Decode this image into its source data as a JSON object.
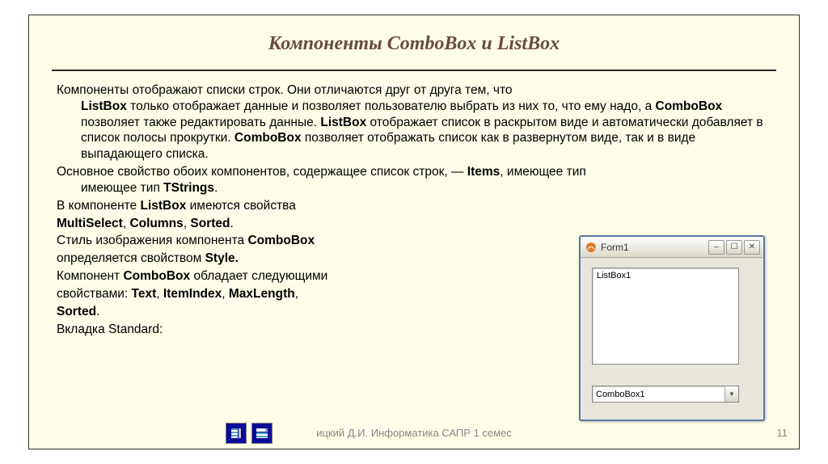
{
  "title": "Компоненты ComboBox и ListBox",
  "para1": {
    "lead": "Компоненты отображают списки строк. Они отличаются друг от друга тем, что",
    "b1": "ListBox",
    "t2": " только отображает данные и позволяет пользователю выбрать из них то, что ему надо, а ",
    "b2": "ComboBox",
    "t3": " позволяет также редактировать данные. ",
    "b3": "ListBox",
    "t4": " отображает список в раскрытом виде и автоматически добавляет в список полосы прокрутки. ",
    "b4": "ComboBox",
    "t5": " позволяет отображать список как в развернутом виде, так и в виде выпадающего списка."
  },
  "para2": {
    "t1": "Основное свойство обоих компонентов, содержащее список строк, — ",
    "b1": "Items",
    "t2": ", имеющее тип ",
    "b2": "TStrings",
    "t3": "."
  },
  "line3a": "В компоненте ",
  "line3b": "ListBox",
  "line3c": " имеются свойства",
  "line4a": "MultiSelect",
  "line4b": ", ",
  "line4c": "Columns",
  "line4d": ", ",
  "line4e": "Sorted",
  "line4f": ".",
  "line5a": "Стиль изображения компонента ",
  "line5b": "ComboBox",
  "line6a": "определяется свойством ",
  "line6b": "Style.",
  "line7a": "Компонент ",
  "line7b": "ComboBox",
  "line7c": " обладает следующими",
  "line8a": "свойствами: ",
  "line8b": "Text",
  "line8c": ", ",
  "line8d": "ItemIndex",
  "line8e": ", ",
  "line8f": "MaxLength",
  "line8g": ",",
  "line9": "Sorted",
  "line9b": ".",
  "line10": "Вкладка Standard:",
  "footer": "ицкий Д.И. Информатика САПР 1 семес",
  "page": "11",
  "form": {
    "title": "Form1",
    "listbox_text": "ListBox1",
    "combo_text": "ComboBox1"
  }
}
